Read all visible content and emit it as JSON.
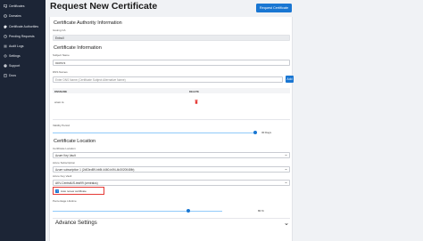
{
  "sidebar": {
    "items": [
      {
        "label": "Certificates",
        "icon": "certificate-icon"
      },
      {
        "label": "Domains",
        "icon": "globe-icon"
      },
      {
        "label": "Certificate Authorities",
        "icon": "authority-icon"
      },
      {
        "label": "Pending Requests",
        "icon": "clock-icon"
      },
      {
        "label": "Audit Logs",
        "icon": "list-icon"
      },
      {
        "label": "Settings",
        "icon": "gear-icon"
      },
      {
        "label": "Support",
        "icon": "help-icon"
      },
      {
        "label": "Docs",
        "icon": "book-icon"
      }
    ]
  },
  "header": {
    "title": "Request New Certificate",
    "request_button": "Request Certificate"
  },
  "ca_section": {
    "title": "Certificate Authority Information",
    "issuing_label": "Issuing CA",
    "issuing_value": "Entra ll"
  },
  "cert_info": {
    "title": "Certificate Information",
    "subject_label": "Subject Name",
    "subject_value": "xcom.rs",
    "dns_label": "DNS Names",
    "dns_placeholder": "Enter DNS Name (Certificate Subject Alternative Name)",
    "add_button": "Add",
    "table_headers": [
      "DNSNAME",
      "DELETE"
    ],
    "rows": [
      {
        "dns": "xcom.rs"
      }
    ],
    "validity_label": "Validity Period",
    "validity_value": "30 Days",
    "validity_fraction": 0.99
  },
  "location": {
    "title": "Certificate Location",
    "location_label": "Certificate Location",
    "location_value": "Azure Key Vault",
    "subscription_label": "Azure Subscription",
    "subscription_value": "Azure subscription 1 (2d03ed59-bb5f-4460-b0f4-4b3020048fb)",
    "vault_label": "Azure Key Vault",
    "vault_value": "AKV-CentralUS-test99 (centralus)",
    "auto_renew_label": "Auto renew certificate",
    "auto_renew_checked": true,
    "percentage_label": "Percentage Lifetime",
    "percentage_value": "80 %",
    "percentage_fraction": 0.8
  },
  "advanced": {
    "title": "Advance Settings"
  },
  "colors": {
    "sidebar_bg": "#1c2536",
    "primary": "#1976d2",
    "highlight": "#e53935"
  }
}
